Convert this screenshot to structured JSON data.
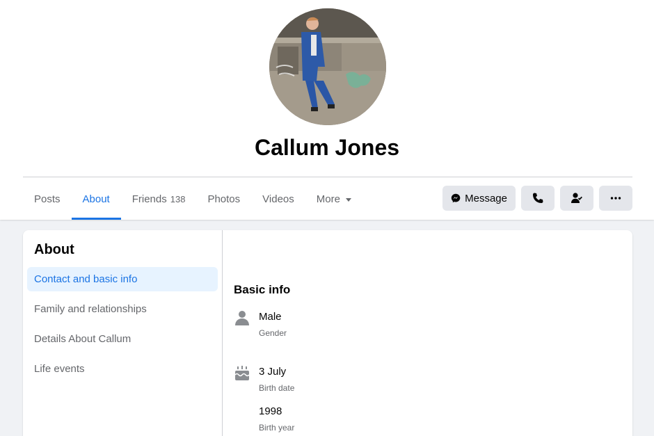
{
  "profile": {
    "name": "Callum Jones"
  },
  "tabs": [
    {
      "label": "Posts"
    },
    {
      "label": "About"
    },
    {
      "label": "Friends",
      "count": "138"
    },
    {
      "label": "Photos"
    },
    {
      "label": "Videos"
    },
    {
      "label": "More"
    }
  ],
  "actions": {
    "message_label": "Message"
  },
  "about": {
    "title": "About",
    "items": [
      {
        "label": "Contact and basic info"
      },
      {
        "label": "Family and relationships"
      },
      {
        "label": "Details About Callum"
      },
      {
        "label": "Life events"
      }
    ]
  },
  "basic_info": {
    "title": "Basic info",
    "gender_value": "Male",
    "gender_label": "Gender",
    "birth_date_value": "3 July",
    "birth_date_label": "Birth date",
    "birth_year_value": "1998",
    "birth_year_label": "Birth year"
  },
  "colors": {
    "accent": "#1b74e4",
    "background": "#f0f2f5",
    "button": "#e4e6eb",
    "secondary_text": "#65676b"
  }
}
